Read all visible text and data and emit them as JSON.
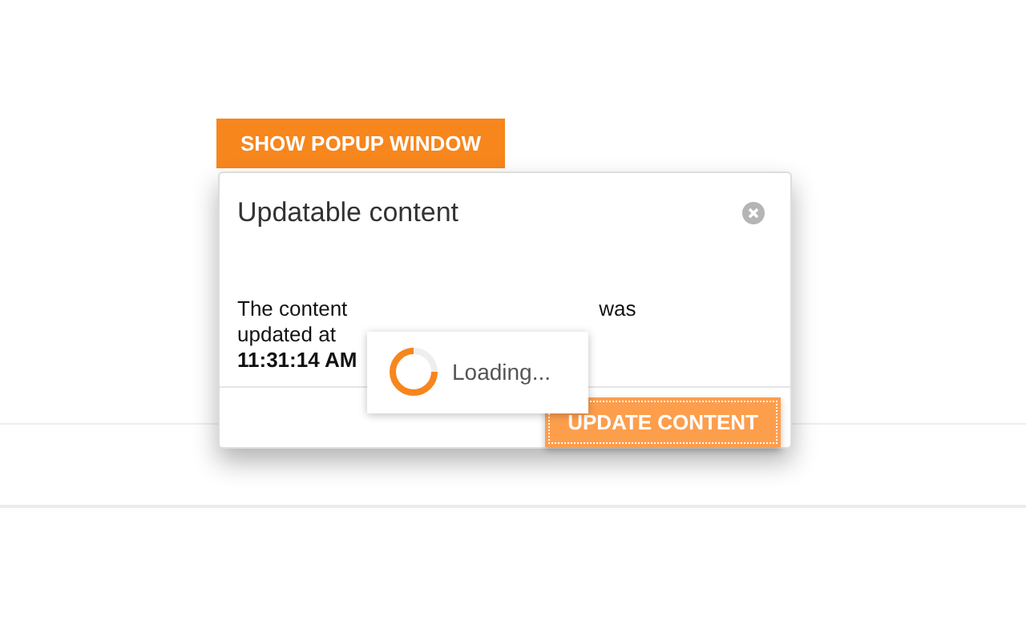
{
  "show_button": {
    "label": "SHOW POPUP WINDOW"
  },
  "popup": {
    "title": "Updatable content",
    "content_visible": [
      "The content",
      "was",
      "updated at"
    ],
    "time": "11:31:14 AM",
    "loading": {
      "visible": true,
      "text": "Loading..."
    },
    "update_button": {
      "label": "UPDATE CONTENT",
      "focused": true
    }
  }
}
